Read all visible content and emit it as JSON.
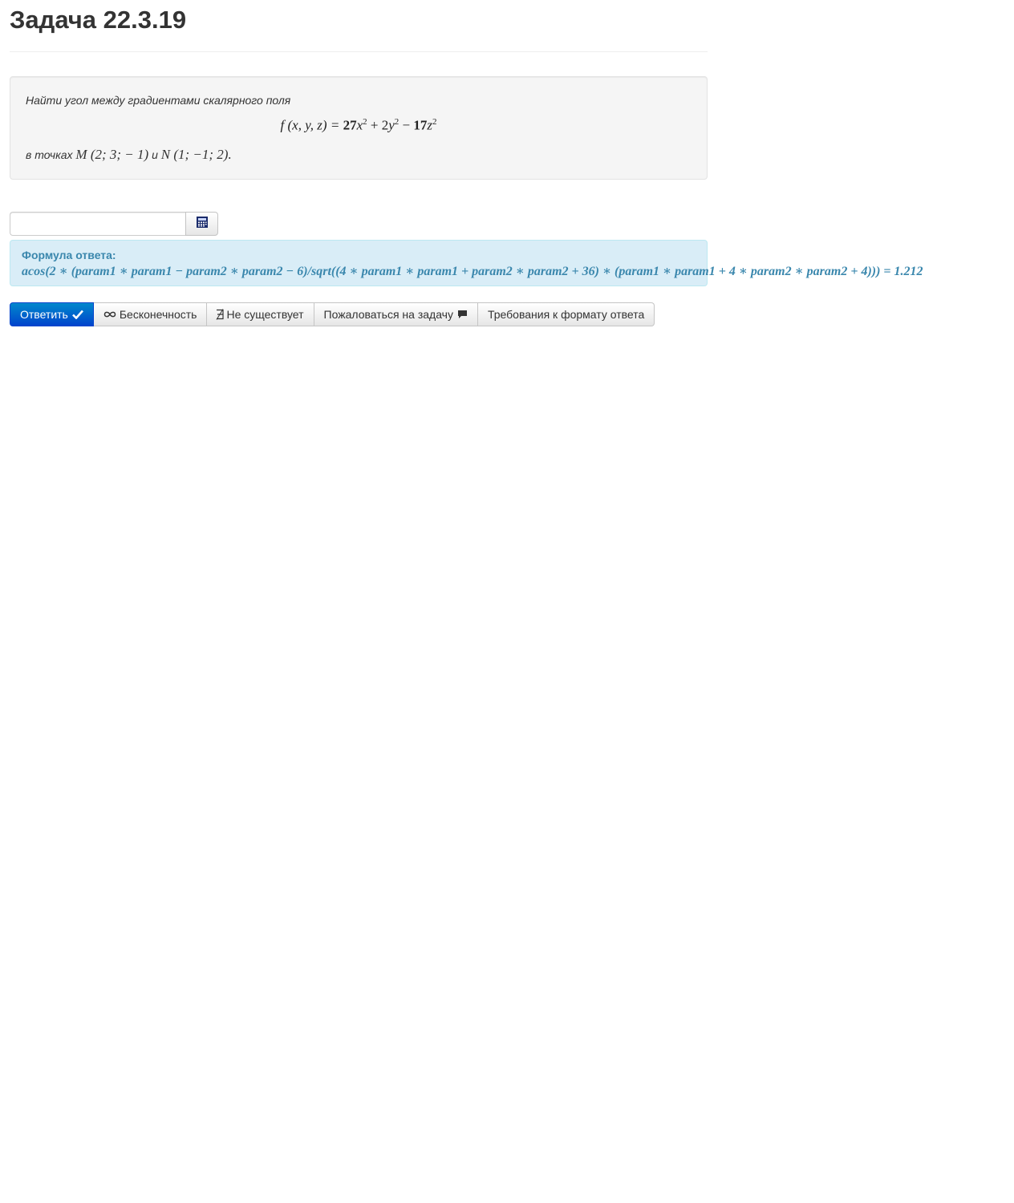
{
  "header": {
    "title": "Задача 22.3.19"
  },
  "problem": {
    "intro": "Найти угол между градиентами скалярного поля",
    "formula": {
      "lhs": "f (x, y, z) = ",
      "c1": "27",
      "t1": "x",
      "p1": "2",
      "plus": " + 2",
      "t2": "y",
      "p2": "2",
      "minus": " − ",
      "c3": "17",
      "t3": "z",
      "p3": "2"
    },
    "points_prefix": "в точках ",
    "point_m": "M (2; 3; − 1)",
    "conj": " и ",
    "point_n": "N (1; −1; 2)."
  },
  "answer": {
    "input_value": "",
    "calculator_icon": "calculator-icon"
  },
  "formula_hint": {
    "label": "Формула ответа:",
    "expression": "acos(2 ∗ (param1 ∗ param1 − param2 ∗ param2 − 6)/sqrt((4 ∗ param1 ∗ param1 + param2 ∗ param2 + 36) ∗ (param1 ∗ param1 + 4 ∗ param2 ∗ param2 + 4))) = 1.212"
  },
  "toolbar": {
    "submit_label": "Ответить",
    "submit_icon": "checkmark-icon",
    "infinity_label": "Бесконечность",
    "infinity_icon": "infinity-icon",
    "not_exists_label": "Не существует",
    "not_exists_icon": "not-exists-icon",
    "complain_label": "Пожаловаться на задачу",
    "complain_icon": "comment-icon",
    "requirements_label": "Требования к формату ответа"
  },
  "colors": {
    "primary": "#0055cc",
    "info_bg": "#d9edf7",
    "info_text": "#3a87ad",
    "well_bg": "#f5f5f5"
  }
}
